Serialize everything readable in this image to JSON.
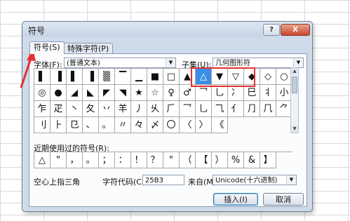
{
  "dialog": {
    "title": "符号",
    "help": "?",
    "close": "X"
  },
  "tabs": [
    {
      "label": "符号(S)",
      "active": true
    },
    {
      "label": "特殊字符(P)",
      "active": false
    }
  ],
  "font": {
    "label": "字体(F):",
    "value": "(普通文本)"
  },
  "subset": {
    "label": "子集(U):",
    "value": "几何图形符"
  },
  "symbols": [
    "▌",
    "▐",
    "▌",
    "▐",
    "▒",
    "▔",
    "▁",
    "■",
    "□",
    "▲",
    "△",
    "▼",
    "▽",
    "◆",
    "◇",
    "○",
    "◎",
    "●",
    "◢",
    "◣",
    "◤",
    "◥",
    "★",
    "☆",
    "♀",
    "♂",
    "乛",
    "乚",
    "冫",
    "巳",
    "丬",
    "小",
    "乍",
    "疋",
    "丶",
    "夂",
    "丷",
    "羊",
    "丿",
    "乆",
    "⺁",
    "⺂",
    "⺃",
    "⺄",
    "⺅",
    "⺆",
    "⺇",
    "⺈",
    "⺉",
    "⺊",
    "⺋",
    "、",
    "。",
    "〃",
    "々",
    "〆",
    "〇",
    "〈",
    "〉",
    "《"
  ],
  "symbols_small": [
    "",
    "",
    "",
    "",
    "",
    "",
    "",
    "",
    "",
    "",
    "",
    "",
    "",
    "",
    "",
    "",
    "",
    "",
    "",
    "",
    "",
    "",
    "",
    "",
    "",
    "",
    "",
    "",
    "",
    "",
    "",
    "",
    "",
    "",
    "",
    "",
    "",
    "",
    "",
    "",
    "",
    "",
    "",
    "",
    "",
    "",
    "",
    "",
    "",
    "",
    "",
    "",
    "",
    "",
    "",
    "",
    "",
    "",
    "",
    ""
  ],
  "selected_symbol": "△",
  "recent": {
    "label": "近期使用过的符号(R):",
    "items": [
      "△",
      "\"",
      "，",
      "。",
      "；",
      "：",
      "！",
      "？",
      "\"",
      "（",
      "【",
      "）",
      "%",
      "&",
      "】"
    ]
  },
  "status": {
    "char_name": "空心上指三角",
    "code_label": "字符代码(C):",
    "code_value": "25B3",
    "from_label": "来自(M):",
    "from_value": "Unicode(十六进制)"
  },
  "buttons": {
    "insert": "插入(I)",
    "cancel": "取消"
  },
  "colors": {
    "highlight": "#e53030",
    "selection": "#3a8ee6",
    "arrow": "#e53030"
  }
}
